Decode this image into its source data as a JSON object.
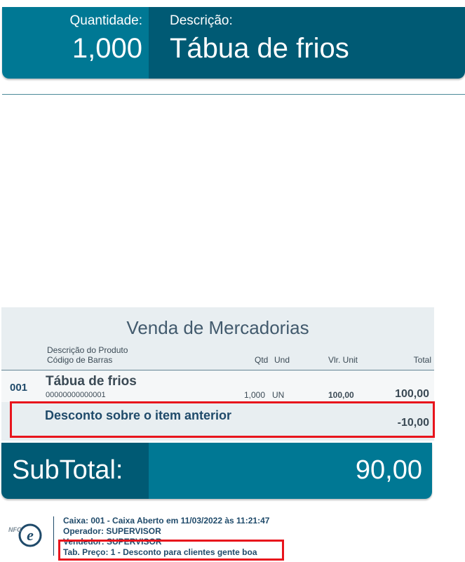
{
  "banner": {
    "qty_label": "Quantidade:",
    "qty_value": "1,000",
    "desc_label": "Descrição:",
    "desc_value": "Tábua de frios"
  },
  "sales": {
    "title": "Venda de Mercadorias",
    "headers": {
      "description": "Descrição do Produto",
      "barcode": "Código de Barras",
      "qtd": "Qtd",
      "und": "Und",
      "unit_price": "Vlr. Unit",
      "total": "Total"
    },
    "items": [
      {
        "seq": "001",
        "name": "Tábua de frios",
        "barcode": "00000000000001",
        "qtd": "1,000",
        "und": "UN",
        "unit_price": "100,00",
        "total": "100,00"
      }
    ],
    "discount": {
      "label": "Desconto sobre o item anterior",
      "value": "-10,00"
    }
  },
  "subtotal": {
    "label": "SubTotal:",
    "value": "90,00"
  },
  "footer": {
    "caixa": "Caixa: 001 - Caixa Aberto em 11/03/2022 às 11:21:47",
    "operador": "Operador: SUPERVISOR",
    "vendedor": "Vendedor: SUPERVISOR",
    "tab_preco": "Tab. Preço: 1 - Desconto para clientes gente boa",
    "logo_text": "NFC e"
  },
  "colors": {
    "primary_dark": "#005a74",
    "primary": "#007894",
    "highlight_red": "#e8141c",
    "panel_bg": "#e8eef1"
  }
}
